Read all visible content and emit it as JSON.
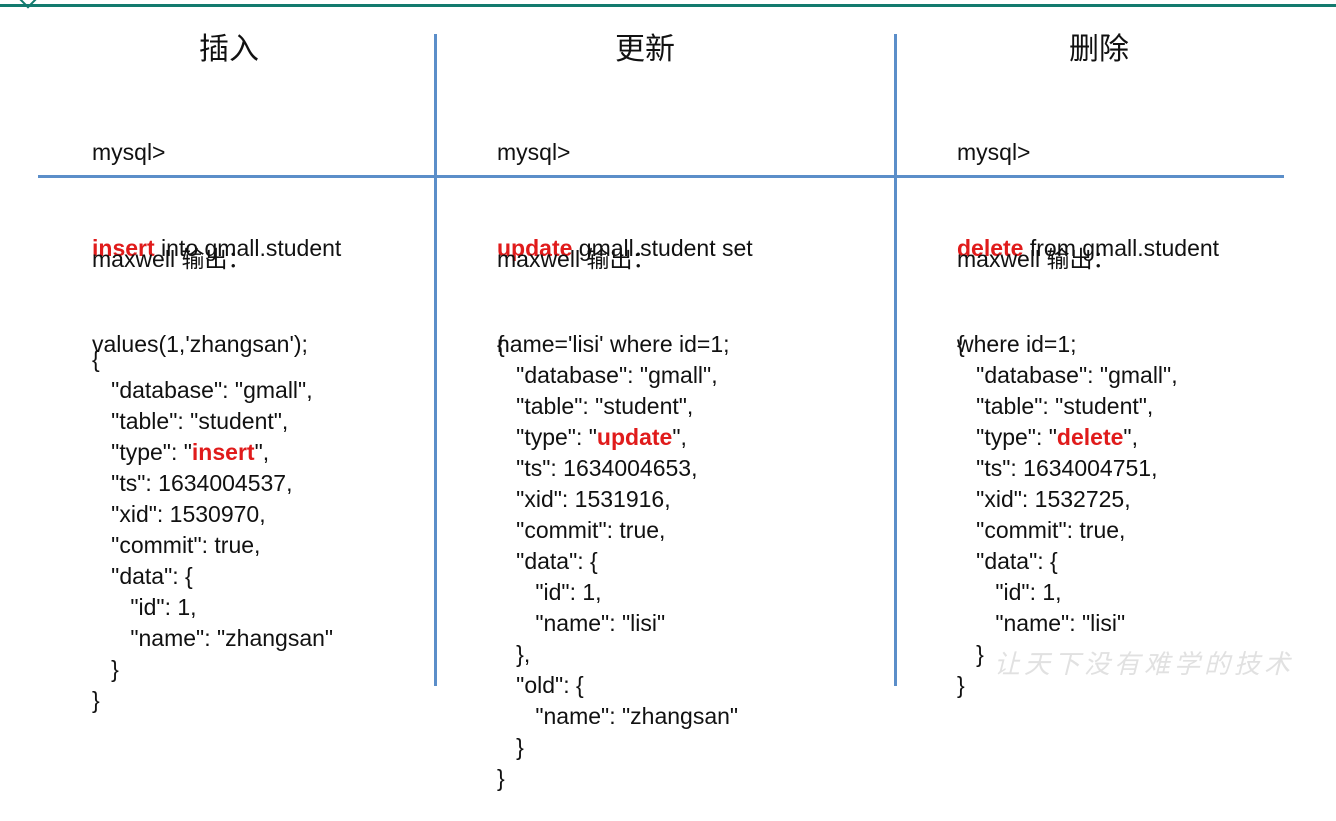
{
  "colors": {
    "topbar": "#137a6e",
    "divider": "#5b8ec9",
    "keyword": "#e01b1b",
    "watermark": "#c9c9c9"
  },
  "columns": [
    {
      "title": "插入",
      "prompt": "mysql>",
      "keyword": "insert",
      "sql_rest": " into gmall.student",
      "sql_line3": "values(1,'zhangsan');",
      "output_label": "maxwell 输出：",
      "json": [
        "{",
        "   \"database\": \"gmall\",",
        "   \"table\": \"student\",",
        [
          "   \"type\": \"",
          "insert",
          "\","
        ],
        "   \"ts\": 1634004537,",
        "   \"xid\": 1530970,",
        "   \"commit\": true,",
        "   \"data\": {",
        "      \"id\": 1,",
        "      \"name\": \"zhangsan\"",
        "   }",
        "}"
      ]
    },
    {
      "title": "更新",
      "prompt": "mysql>",
      "keyword": "update",
      "sql_rest": " gmall.student set",
      "sql_line3": "name='lisi' where id=1;",
      "output_label": "maxwell 输出：",
      "json": [
        "{",
        "   \"database\": \"gmall\",",
        "   \"table\": \"student\",",
        [
          "   \"type\": \"",
          "update",
          "\","
        ],
        "   \"ts\": 1634004653,",
        "   \"xid\": 1531916,",
        "   \"commit\": true,",
        "   \"data\": {",
        "      \"id\": 1,",
        "      \"name\": \"lisi\"",
        "   },",
        "   \"old\": {",
        "      \"name\": \"zhangsan\"",
        "   }",
        "}"
      ]
    },
    {
      "title": "删除",
      "prompt": "mysql>",
      "keyword": "delete",
      "sql_rest": " from gmall.student",
      "sql_line3": "where id=1;",
      "output_label": "maxwell 输出：",
      "json": [
        "{",
        "   \"database\": \"gmall\",",
        "   \"table\": \"student\",",
        [
          "   \"type\": \"",
          "delete",
          "\","
        ],
        "   \"ts\": 1634004751,",
        "   \"xid\": 1532725,",
        "   \"commit\": true,",
        "   \"data\": {",
        "      \"id\": 1,",
        "      \"name\": \"lisi\"",
        "   }",
        "}"
      ]
    }
  ],
  "watermark": "让天下没有难学的技术"
}
